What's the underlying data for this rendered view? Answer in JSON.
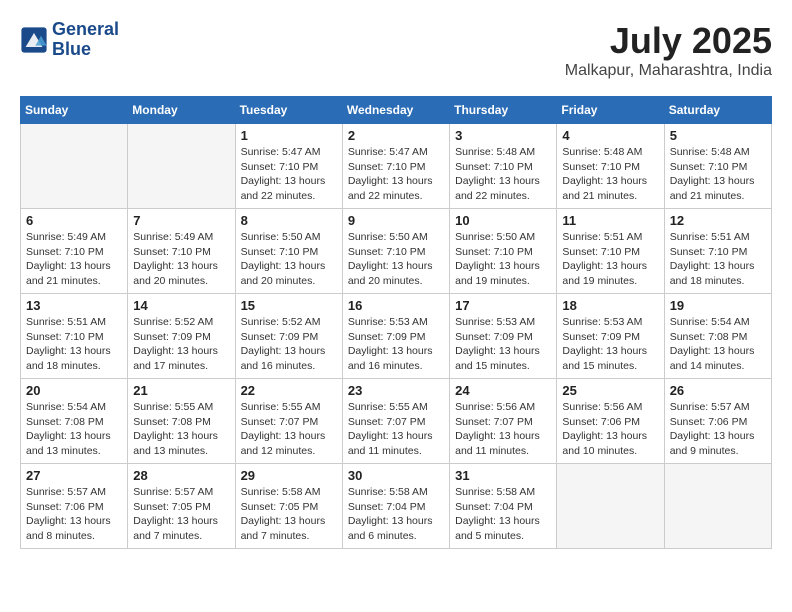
{
  "header": {
    "logo_line1": "General",
    "logo_line2": "Blue",
    "month_year": "July 2025",
    "location": "Malkapur, Maharashtra, India"
  },
  "weekdays": [
    "Sunday",
    "Monday",
    "Tuesday",
    "Wednesday",
    "Thursday",
    "Friday",
    "Saturday"
  ],
  "weeks": [
    [
      {
        "day": "",
        "info": ""
      },
      {
        "day": "",
        "info": ""
      },
      {
        "day": "1",
        "info": "Sunrise: 5:47 AM\nSunset: 7:10 PM\nDaylight: 13 hours\nand 22 minutes."
      },
      {
        "day": "2",
        "info": "Sunrise: 5:47 AM\nSunset: 7:10 PM\nDaylight: 13 hours\nand 22 minutes."
      },
      {
        "day": "3",
        "info": "Sunrise: 5:48 AM\nSunset: 7:10 PM\nDaylight: 13 hours\nand 22 minutes."
      },
      {
        "day": "4",
        "info": "Sunrise: 5:48 AM\nSunset: 7:10 PM\nDaylight: 13 hours\nand 21 minutes."
      },
      {
        "day": "5",
        "info": "Sunrise: 5:48 AM\nSunset: 7:10 PM\nDaylight: 13 hours\nand 21 minutes."
      }
    ],
    [
      {
        "day": "6",
        "info": "Sunrise: 5:49 AM\nSunset: 7:10 PM\nDaylight: 13 hours\nand 21 minutes."
      },
      {
        "day": "7",
        "info": "Sunrise: 5:49 AM\nSunset: 7:10 PM\nDaylight: 13 hours\nand 20 minutes."
      },
      {
        "day": "8",
        "info": "Sunrise: 5:50 AM\nSunset: 7:10 PM\nDaylight: 13 hours\nand 20 minutes."
      },
      {
        "day": "9",
        "info": "Sunrise: 5:50 AM\nSunset: 7:10 PM\nDaylight: 13 hours\nand 20 minutes."
      },
      {
        "day": "10",
        "info": "Sunrise: 5:50 AM\nSunset: 7:10 PM\nDaylight: 13 hours\nand 19 minutes."
      },
      {
        "day": "11",
        "info": "Sunrise: 5:51 AM\nSunset: 7:10 PM\nDaylight: 13 hours\nand 19 minutes."
      },
      {
        "day": "12",
        "info": "Sunrise: 5:51 AM\nSunset: 7:10 PM\nDaylight: 13 hours\nand 18 minutes."
      }
    ],
    [
      {
        "day": "13",
        "info": "Sunrise: 5:51 AM\nSunset: 7:10 PM\nDaylight: 13 hours\nand 18 minutes."
      },
      {
        "day": "14",
        "info": "Sunrise: 5:52 AM\nSunset: 7:09 PM\nDaylight: 13 hours\nand 17 minutes."
      },
      {
        "day": "15",
        "info": "Sunrise: 5:52 AM\nSunset: 7:09 PM\nDaylight: 13 hours\nand 16 minutes."
      },
      {
        "day": "16",
        "info": "Sunrise: 5:53 AM\nSunset: 7:09 PM\nDaylight: 13 hours\nand 16 minutes."
      },
      {
        "day": "17",
        "info": "Sunrise: 5:53 AM\nSunset: 7:09 PM\nDaylight: 13 hours\nand 15 minutes."
      },
      {
        "day": "18",
        "info": "Sunrise: 5:53 AM\nSunset: 7:09 PM\nDaylight: 13 hours\nand 15 minutes."
      },
      {
        "day": "19",
        "info": "Sunrise: 5:54 AM\nSunset: 7:08 PM\nDaylight: 13 hours\nand 14 minutes."
      }
    ],
    [
      {
        "day": "20",
        "info": "Sunrise: 5:54 AM\nSunset: 7:08 PM\nDaylight: 13 hours\nand 13 minutes."
      },
      {
        "day": "21",
        "info": "Sunrise: 5:55 AM\nSunset: 7:08 PM\nDaylight: 13 hours\nand 13 minutes."
      },
      {
        "day": "22",
        "info": "Sunrise: 5:55 AM\nSunset: 7:07 PM\nDaylight: 13 hours\nand 12 minutes."
      },
      {
        "day": "23",
        "info": "Sunrise: 5:55 AM\nSunset: 7:07 PM\nDaylight: 13 hours\nand 11 minutes."
      },
      {
        "day": "24",
        "info": "Sunrise: 5:56 AM\nSunset: 7:07 PM\nDaylight: 13 hours\nand 11 minutes."
      },
      {
        "day": "25",
        "info": "Sunrise: 5:56 AM\nSunset: 7:06 PM\nDaylight: 13 hours\nand 10 minutes."
      },
      {
        "day": "26",
        "info": "Sunrise: 5:57 AM\nSunset: 7:06 PM\nDaylight: 13 hours\nand 9 minutes."
      }
    ],
    [
      {
        "day": "27",
        "info": "Sunrise: 5:57 AM\nSunset: 7:06 PM\nDaylight: 13 hours\nand 8 minutes."
      },
      {
        "day": "28",
        "info": "Sunrise: 5:57 AM\nSunset: 7:05 PM\nDaylight: 13 hours\nand 7 minutes."
      },
      {
        "day": "29",
        "info": "Sunrise: 5:58 AM\nSunset: 7:05 PM\nDaylight: 13 hours\nand 7 minutes."
      },
      {
        "day": "30",
        "info": "Sunrise: 5:58 AM\nSunset: 7:04 PM\nDaylight: 13 hours\nand 6 minutes."
      },
      {
        "day": "31",
        "info": "Sunrise: 5:58 AM\nSunset: 7:04 PM\nDaylight: 13 hours\nand 5 minutes."
      },
      {
        "day": "",
        "info": ""
      },
      {
        "day": "",
        "info": ""
      }
    ]
  ]
}
